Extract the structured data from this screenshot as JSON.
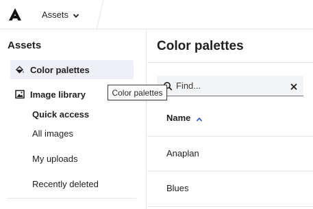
{
  "topbar": {
    "logo_icon": "anaplan-logo-icon",
    "assets_menu_label": "Assets",
    "assets_menu_icon": "chevron-down-icon"
  },
  "sidebar": {
    "title": "Assets",
    "items": [
      {
        "label": "Color palettes",
        "icon": "paint-bucket-icon",
        "active": true
      },
      {
        "label": "Image library",
        "icon": "image-icon",
        "active": false
      }
    ],
    "sub_items": [
      {
        "label": "Quick access",
        "bold": true
      },
      {
        "label": "All images",
        "bold": false
      },
      {
        "label": "My uploads",
        "bold": false
      },
      {
        "label": "Recently deleted",
        "bold": false
      }
    ]
  },
  "tooltip": {
    "text": "Color palettes"
  },
  "main": {
    "title": "Color palettes",
    "search": {
      "placeholder": "Find...",
      "value": ""
    },
    "table": {
      "column_header": "Name",
      "sort": "ascending",
      "rows": [
        "Anaplan",
        "Blues"
      ]
    }
  },
  "colors": {
    "active_bg": "#eef0f5",
    "search_bg": "#f3f4f6",
    "divider": "#e6e6e6",
    "accent": "#3e59c7"
  }
}
